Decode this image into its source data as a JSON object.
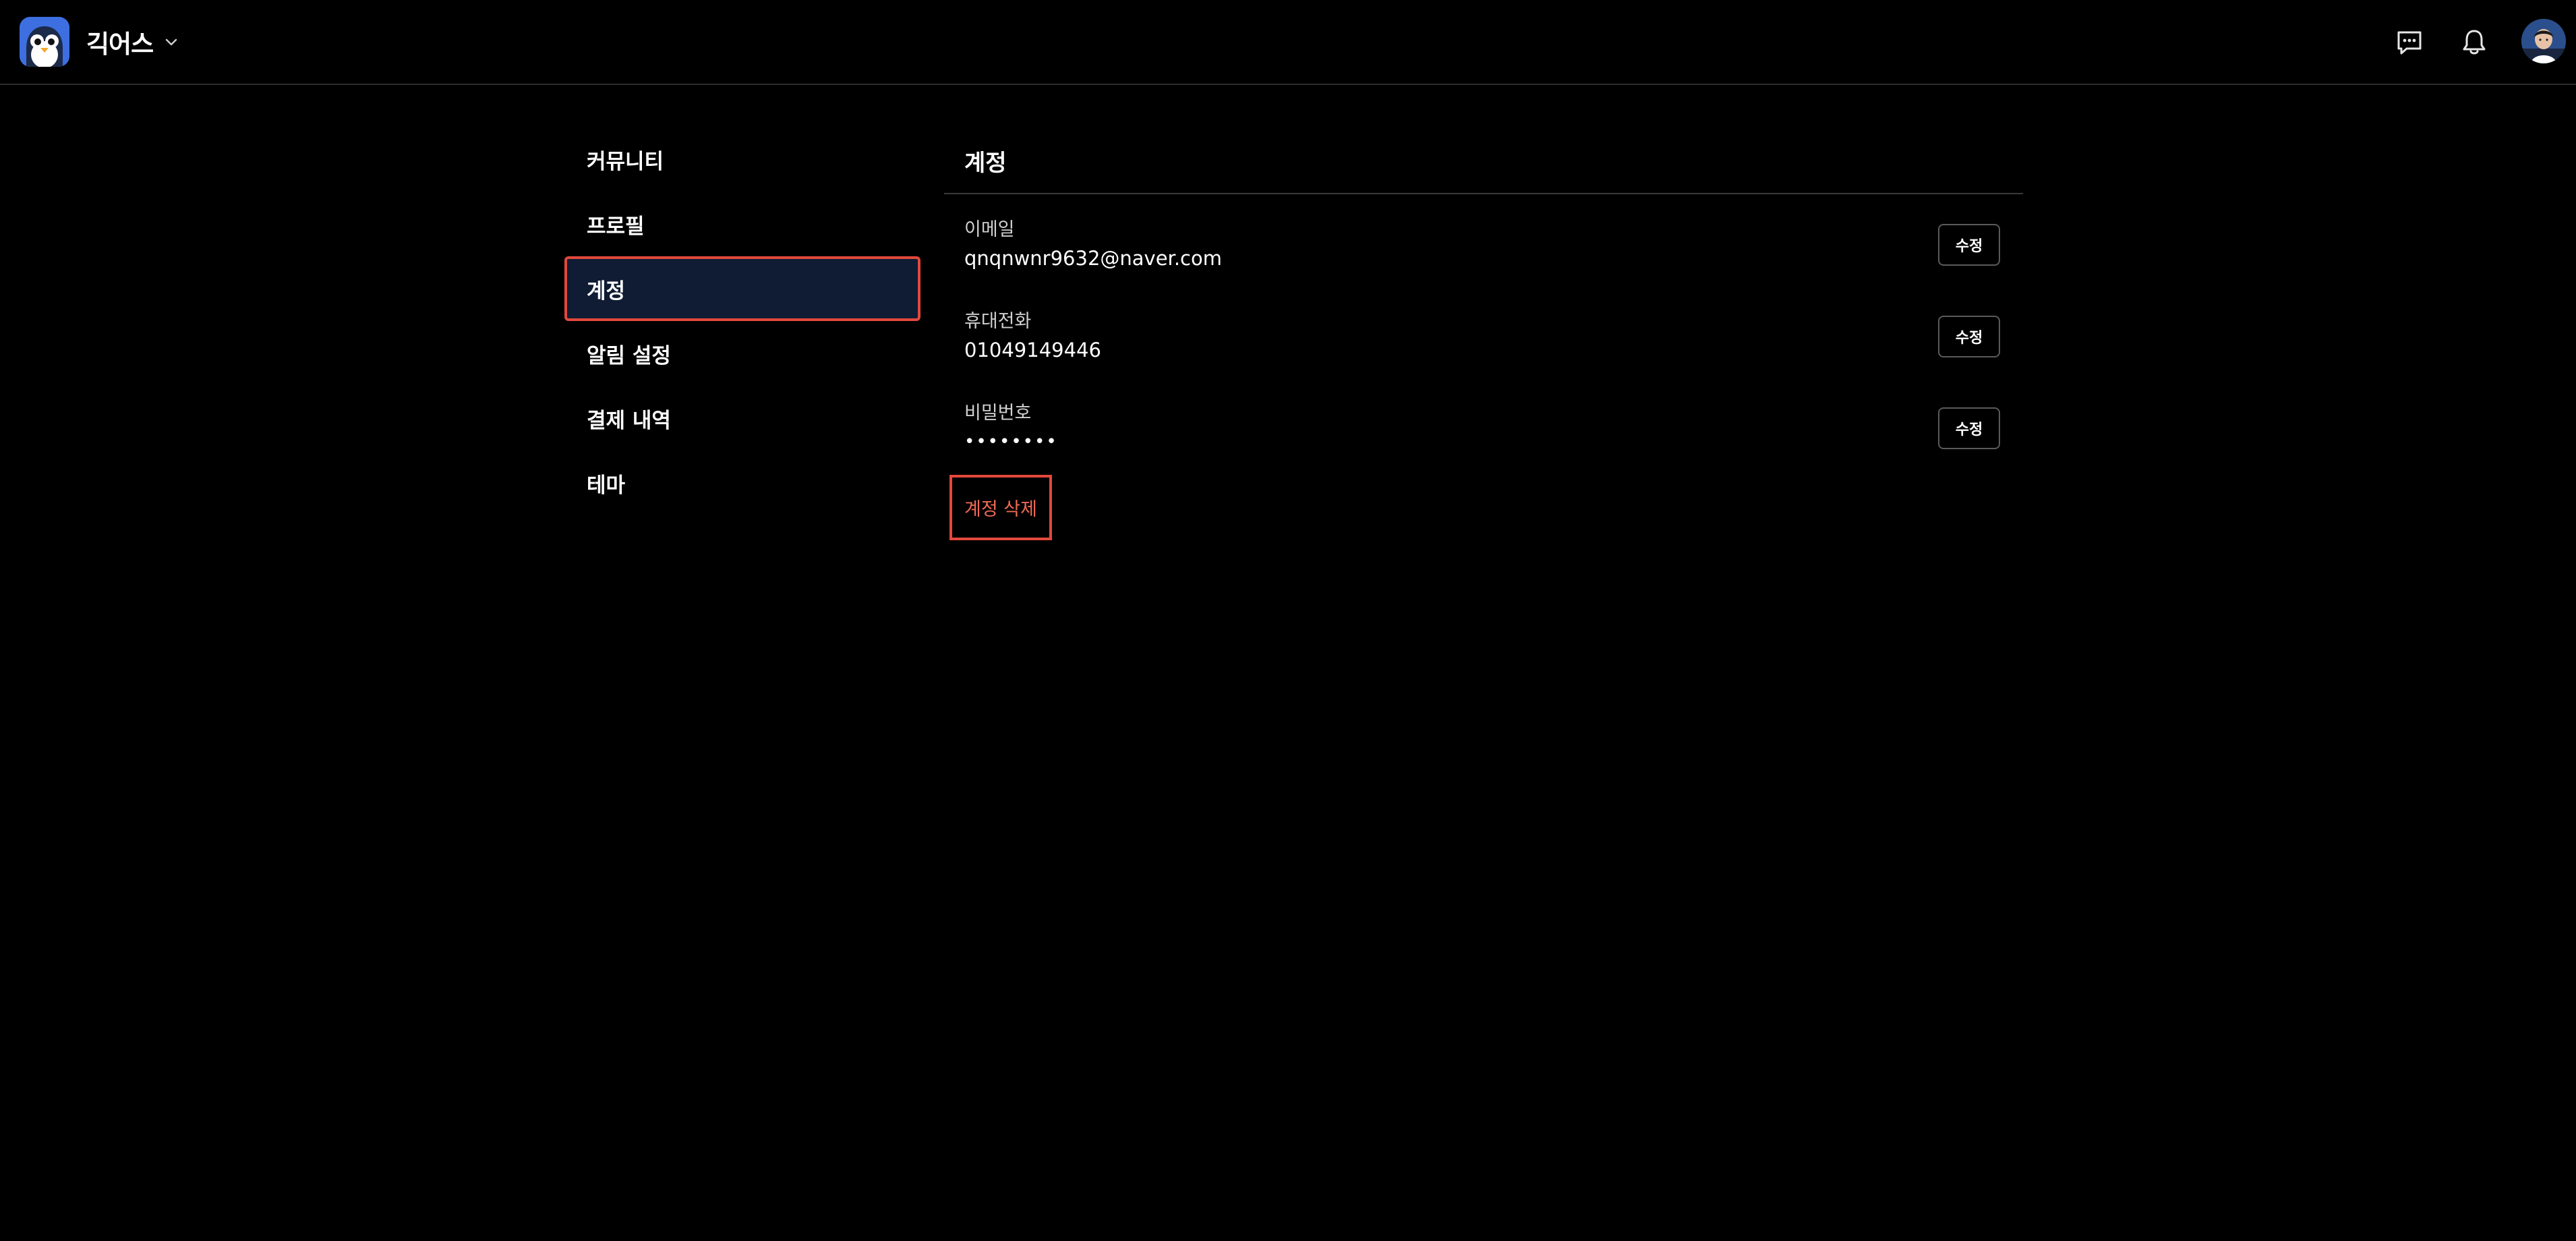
{
  "header": {
    "app_name": "긱어스",
    "icons": [
      "app-logo",
      "chevron-down-icon",
      "chat-icon",
      "bell-icon",
      "avatar"
    ]
  },
  "sidebar": {
    "items": [
      {
        "label": "커뮤니티",
        "active": false
      },
      {
        "label": "프로필",
        "active": false
      },
      {
        "label": "계정",
        "active": true
      },
      {
        "label": "알림 설정",
        "active": false
      },
      {
        "label": "결제 내역",
        "active": false
      },
      {
        "label": "테마",
        "active": false
      }
    ]
  },
  "account": {
    "title": "계정",
    "fields": [
      {
        "label": "이메일",
        "value": "qnqnwnr9632@naver.com",
        "edit_label": "수정"
      },
      {
        "label": "휴대전화",
        "value": "01049149446",
        "edit_label": "수정"
      },
      {
        "label": "비밀번호",
        "value": "••••••••",
        "edit_label": "수정"
      }
    ],
    "delete_label": "계정 삭제"
  },
  "colors": {
    "background": "#000000",
    "active_item_bg": "#0f1c33",
    "highlight_outline": "#e2483b",
    "danger_text": "#ee6b56",
    "logo_blue": "#3d6fe0"
  }
}
